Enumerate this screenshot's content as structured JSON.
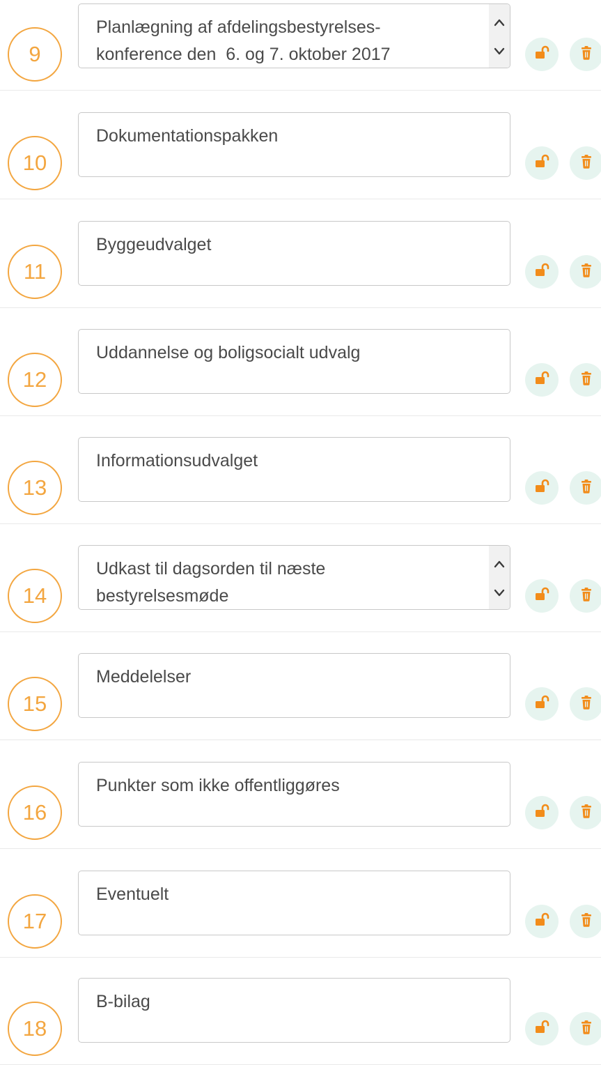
{
  "agenda": {
    "items": [
      {
        "number": "9",
        "text": "Planlægning af afdelingsbestyrelses-\nkonference den  6. og 7. oktober 2017",
        "scrollbar": true
      },
      {
        "number": "10",
        "text": "Dokumentationspakken",
        "scrollbar": false
      },
      {
        "number": "11",
        "text": "Byggeudvalget",
        "scrollbar": false
      },
      {
        "number": "12",
        "text": "Uddannelse og boligsocialt udvalg",
        "scrollbar": false
      },
      {
        "number": "13",
        "text": "Informationsudvalget",
        "scrollbar": false
      },
      {
        "number": "14",
        "text": "Udkast til dagsorden til næste\nbestyrelsesmøde",
        "scrollbar": true
      },
      {
        "number": "15",
        "text": "Meddelelser",
        "scrollbar": false
      },
      {
        "number": "16",
        "text": "Punkter som ikke offentliggøres",
        "scrollbar": false
      },
      {
        "number": "17",
        "text": "Eventuelt",
        "scrollbar": false
      },
      {
        "number": "18",
        "text": "B-bilag",
        "scrollbar": false
      }
    ]
  },
  "icons": {
    "lock": "unlock-icon",
    "delete": "trash-icon",
    "scroll_up": "chevron-up-icon",
    "scroll_down": "chevron-down-icon"
  },
  "colors": {
    "accent": "#f3a640",
    "button_bg": "#e6f4ef",
    "icon": "#f28c1a",
    "field_border": "#c8c8c8",
    "text": "#4a4a4a"
  }
}
